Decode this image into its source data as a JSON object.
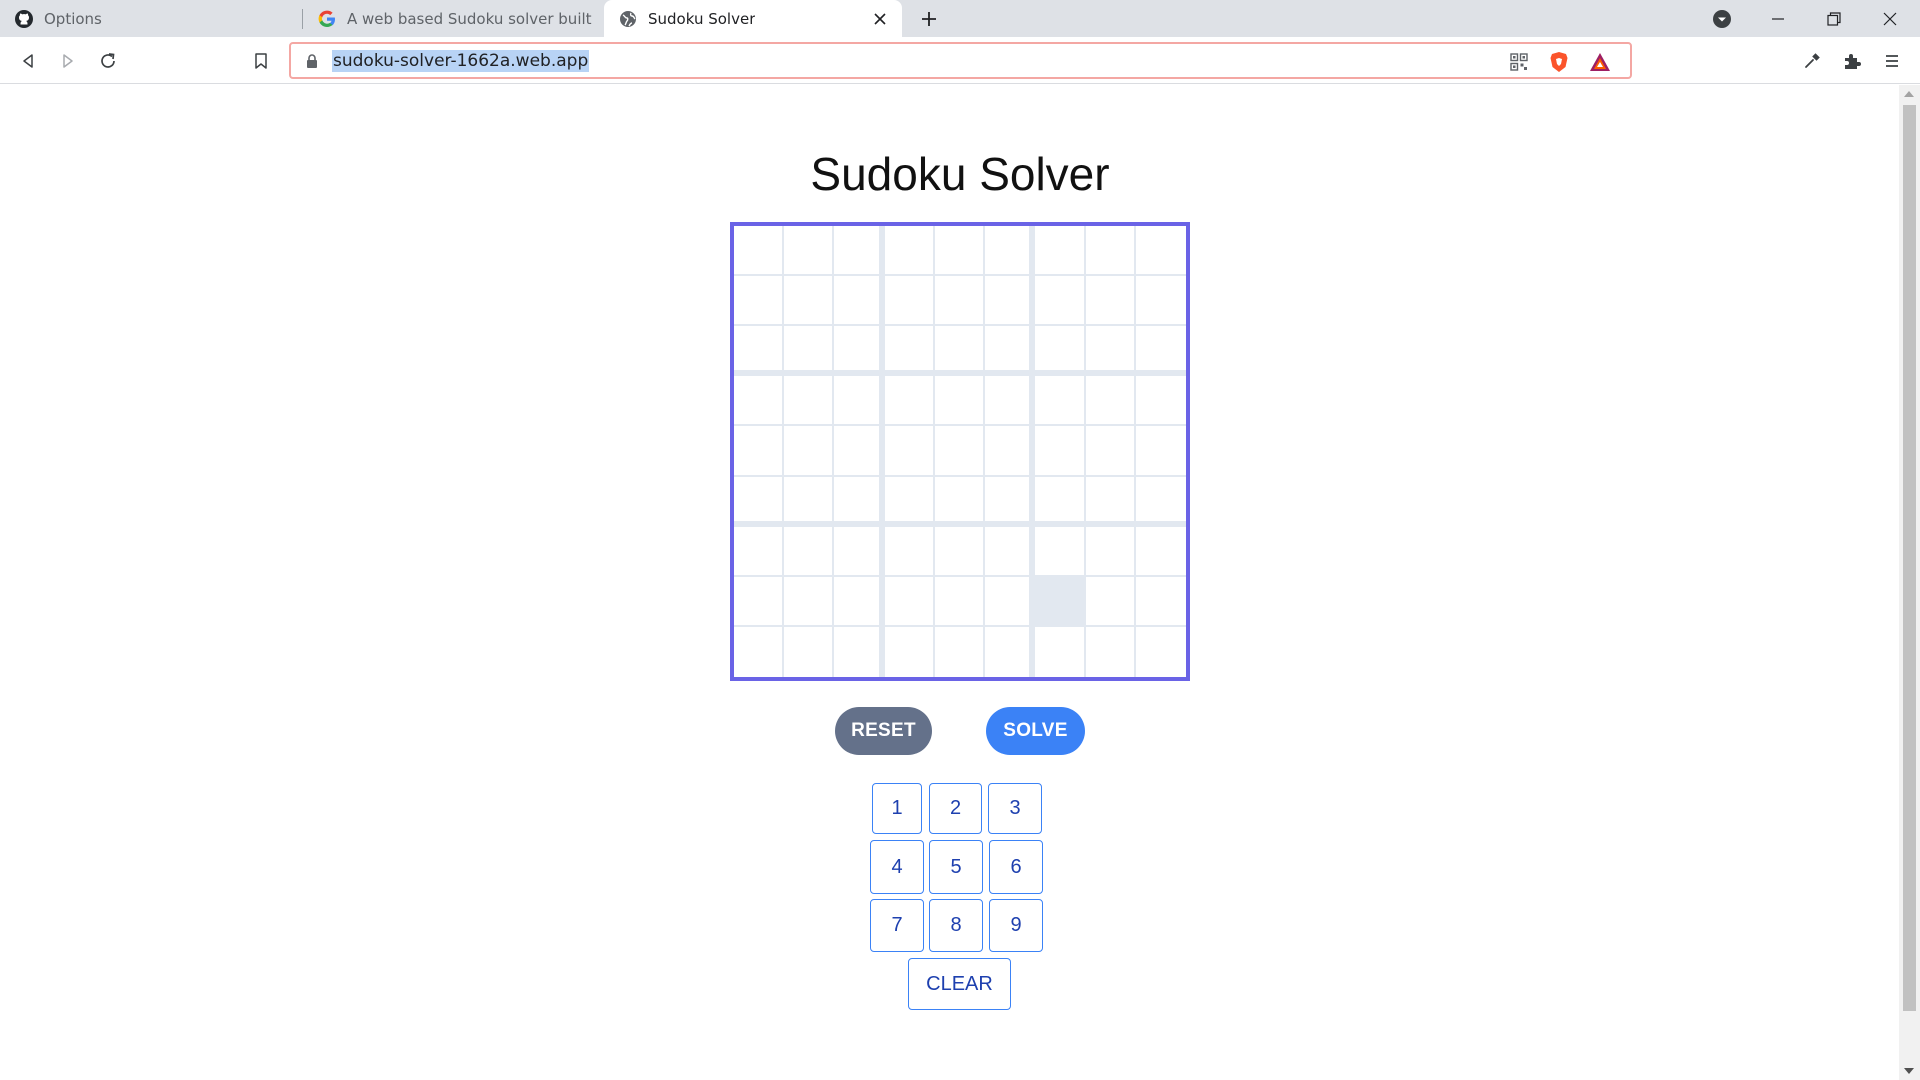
{
  "browser": {
    "tabs": [
      {
        "title": "Options",
        "icon": "github-icon"
      },
      {
        "title": "A web based Sudoku solver built using",
        "icon": "google-icon"
      },
      {
        "title": "Sudoku Solver",
        "icon": "globe-icon",
        "active": true
      }
    ],
    "url": "sudoku-solver-1662a.web.app"
  },
  "page": {
    "title": "Sudoku Solver",
    "buttons": {
      "reset": "RESET",
      "solve": "SOLVE"
    },
    "keypad": [
      "1",
      "2",
      "3",
      "4",
      "5",
      "6",
      "7",
      "8",
      "9"
    ],
    "clear": "CLEAR"
  },
  "board": {
    "values": [
      [
        "",
        "",
        "",
        "",
        "",
        "",
        "",
        "",
        ""
      ],
      [
        "",
        "",
        "",
        "",
        "",
        "",
        "",
        "",
        ""
      ],
      [
        "",
        "",
        "",
        "",
        "",
        "",
        "",
        "",
        ""
      ],
      [
        "",
        "",
        "",
        "",
        "",
        "",
        "",
        "",
        ""
      ],
      [
        "",
        "",
        "",
        "",
        "",
        "",
        "",
        "",
        ""
      ],
      [
        "",
        "",
        "",
        "",
        "",
        "",
        "",
        "",
        ""
      ],
      [
        "",
        "",
        "",
        "",
        "",
        "",
        "",
        "",
        ""
      ],
      [
        "",
        "",
        "",
        "",
        "",
        "",
        "",
        "",
        ""
      ],
      [
        "",
        "",
        "",
        "",
        "",
        "",
        "",
        "",
        ""
      ]
    ],
    "selected": {
      "row": 7,
      "col": 6
    }
  },
  "colors": {
    "board_border": "#6a63e6",
    "reset": "#64718a",
    "solve": "#3b82f6",
    "key_text": "#1e40af"
  }
}
